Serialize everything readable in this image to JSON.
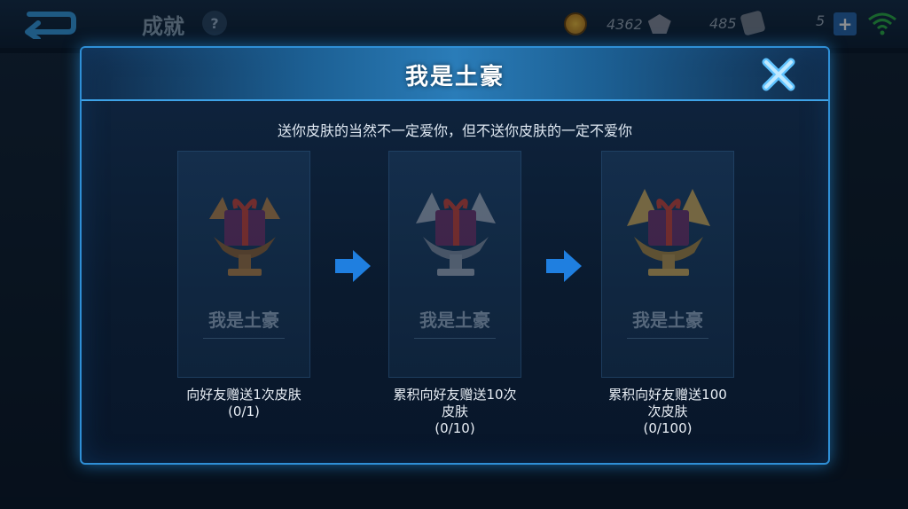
{
  "topbar": {
    "page_title": "成就",
    "help_icon": "?",
    "gold_value": "4362",
    "gem_value": "485",
    "ticket_value": "5",
    "plus_label": "+"
  },
  "modal": {
    "title": "我是土豪",
    "subtitle": "送你皮肤的当然不一定爱你，但不送你皮肤的一定不爱你",
    "cards": [
      {
        "title": "我是土豪",
        "sub": "",
        "desc_line1": "向好友赠送1次皮肤",
        "desc_line2": "(0/1)"
      },
      {
        "title": "我是土豪",
        "sub": "",
        "desc_line1": "累积向好友赠送10次",
        "desc_line2": "皮肤",
        "desc_line3": "(0/10)"
      },
      {
        "title": "我是土豪",
        "sub": "",
        "desc_line1": "累积向好友赠送100",
        "desc_line2": "次皮肤",
        "desc_line3": "(0/100)"
      }
    ]
  },
  "colors": {
    "accent": "#2f8fd6",
    "arrow": "#1f7fe0",
    "bronze": "#b07a3c",
    "silver": "#9aa3b0",
    "gold": "#caa24e",
    "gift": "#6b2c5e",
    "ribbon": "#c23a2a"
  },
  "icons": {
    "back": "back-arrow-icon",
    "close": "close-x-icon",
    "arrow": "right-arrow-icon"
  }
}
